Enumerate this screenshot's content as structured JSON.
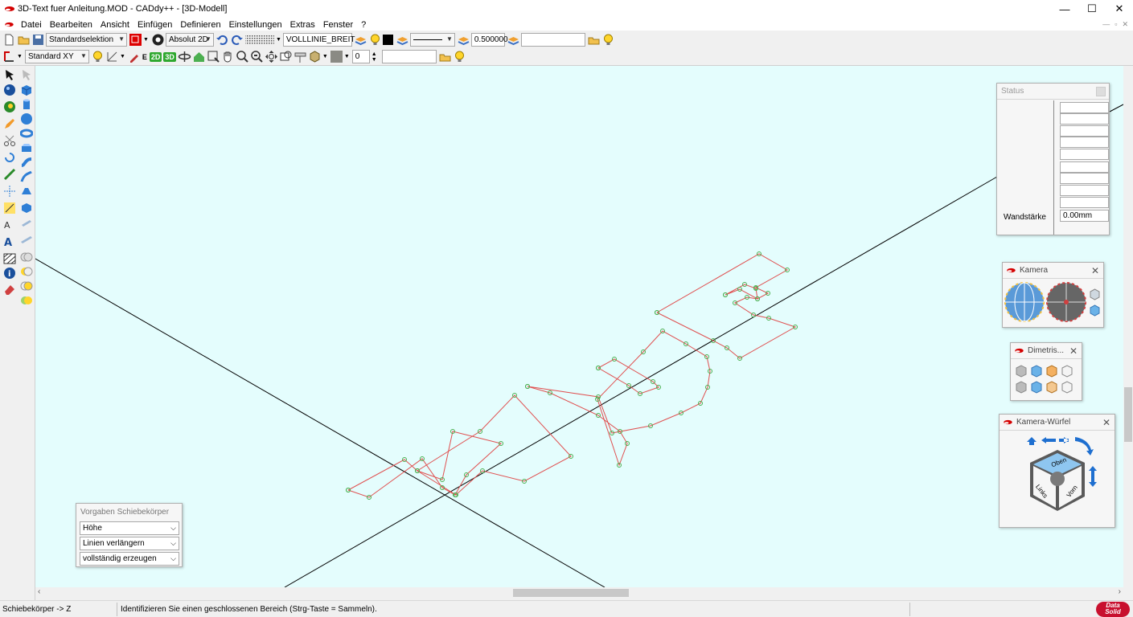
{
  "window": {
    "title": "3D-Text fuer Anleitung.MOD  -  CADdy++ - [3D-Modell]",
    "controls": {
      "minimize": "—",
      "maximize": "☐",
      "close": "✕"
    }
  },
  "menu": {
    "items": [
      "Datei",
      "Bearbeiten",
      "Ansicht",
      "Einfügen",
      "Definieren",
      "Einstellungen",
      "Extras",
      "Fenster",
      "?"
    ],
    "mdi_controls": [
      "—",
      "▫",
      "✕"
    ]
  },
  "toolbar1": {
    "selection_mode": "Standardselektion",
    "coord_mode": "Absolut 2D",
    "layer_name": "VOLLLINIE_BREIT",
    "line_width": "0.500000",
    "empty_field": ""
  },
  "toolbar2": {
    "plane": "Standard XY",
    "badge_2d": "2D",
    "badge_3d": "3D",
    "e_label": "E",
    "counter": "0",
    "empty_field": ""
  },
  "status_panel": {
    "title": "Status",
    "wall_label": "Wandstärke",
    "wall_value": "0.00mm"
  },
  "kamera_panel": {
    "title": "Kamera"
  },
  "dimetrie_panel": {
    "title": "Dimetris..."
  },
  "cube_panel": {
    "title": "Kamera-Würfel",
    "face_top": "Oben",
    "face_left": "Links",
    "face_front": "Vorn"
  },
  "vorgaben_panel": {
    "title": "Vorgaben Schiebekörper",
    "option1": "Höhe",
    "option2": "Linien verlängern",
    "option3": "vollständig erzeugen"
  },
  "statusbar": {
    "mode": "Schiebekörper -> Z",
    "hint": "Identifizieren Sie einen geschlossenen Bereich (Strg-Taste = Sammeln).",
    "logo_line1": "Data",
    "logo_line2": "Solid"
  },
  "colors": {
    "canvas_bg": "#e4fdfd",
    "contour": "#e05050",
    "vertex": "#4caf50",
    "axis": "#000000",
    "brand_red": "#c8102e"
  }
}
